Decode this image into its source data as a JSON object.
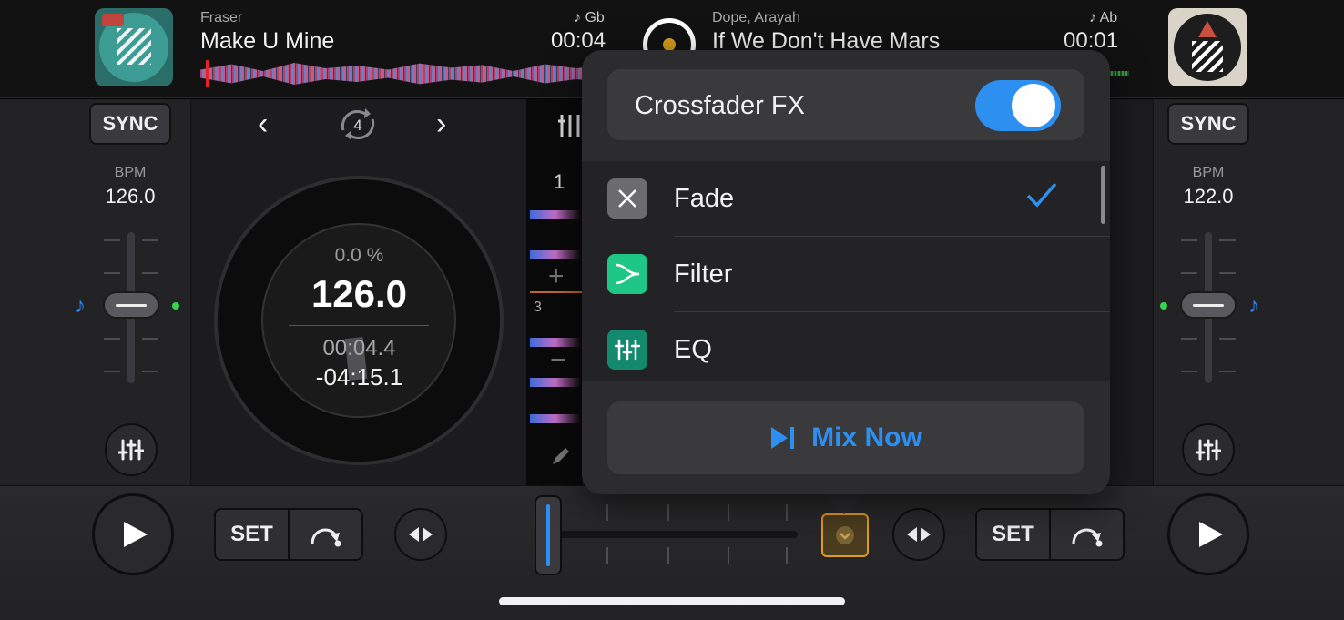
{
  "deck_a": {
    "artist": "Fraser",
    "title": "Make U Mine",
    "key": "♪ Gb",
    "time": "00:04",
    "sync_label": "SYNC",
    "bpm_label": "BPM",
    "bpm_value": "126.0",
    "pitch_percent": "0.0 %",
    "big_bpm": "126.0",
    "elapsed": "00:04.4",
    "remaining": "-04:15.1",
    "loop_count": "4",
    "set_label": "SET"
  },
  "deck_b": {
    "artist": "Dope, Arayah",
    "title": "If We Don't Have Mars",
    "key": "♪ Ab",
    "time": "00:01",
    "sync_label": "SYNC",
    "bpm_label": "BPM",
    "bpm_value": "122.0",
    "set_label": "SET"
  },
  "browser_strip": {
    "row_num_1": "1",
    "row_num_3": "3",
    "plus": "+",
    "minus": "−"
  },
  "popover": {
    "toggle_label": "Crossfader FX",
    "toggle_on": true,
    "items": [
      {
        "label": "Fade",
        "icon": "x-icon",
        "selected": true,
        "color": "#6b6b70"
      },
      {
        "label": "Filter",
        "icon": "filter-icon",
        "selected": false,
        "color": "#1ec785"
      },
      {
        "label": "EQ",
        "icon": "eq-icon",
        "selected": false,
        "color": "#138a6e"
      }
    ],
    "mix_now_label": "Mix Now"
  },
  "colors": {
    "accent_blue": "#2d8ff0",
    "fx_button_orange": "#e49a1b"
  }
}
